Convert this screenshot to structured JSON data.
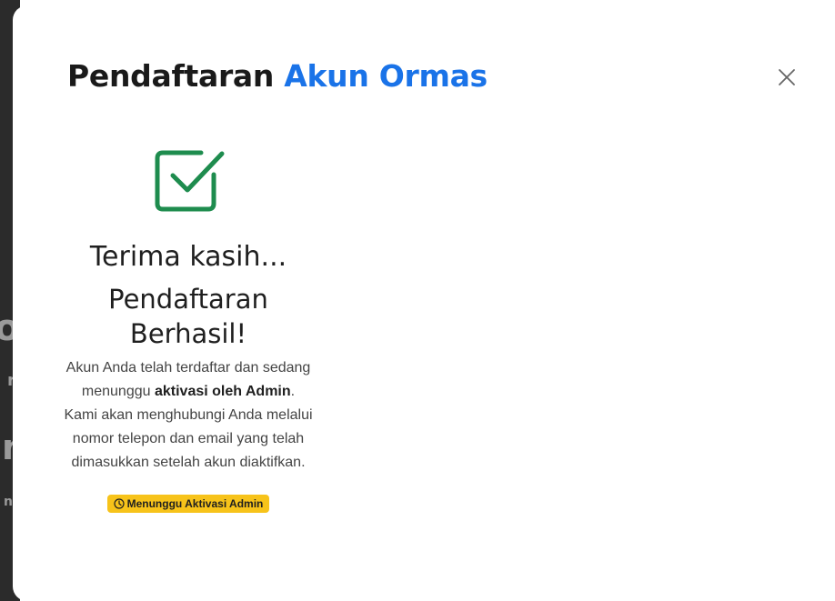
{
  "modal": {
    "title_part1": "Pendaftaran",
    "title_part2": "Akun Ormas",
    "close_icon": "close-icon",
    "accent_color": "#1a73e8"
  },
  "success": {
    "icon": "check-square-icon",
    "icon_color": "#1e8c4e",
    "thanks": "Terima kasih...",
    "headline": "Pendaftaran Berhasil!",
    "message_part1": "Akun Anda telah terdaftar dan sedang menunggu ",
    "message_bold1": "aktivasi oleh Admin",
    "message_part2": ". Kami akan menghubungi Anda melalui nomor telepon dan email yang telah dimasukkan setelah akun diaktifkan.",
    "badge_icon": "clock-icon",
    "badge_label": "Menunggu Aktivasi Admin",
    "badge_color": "#f7c31a"
  }
}
